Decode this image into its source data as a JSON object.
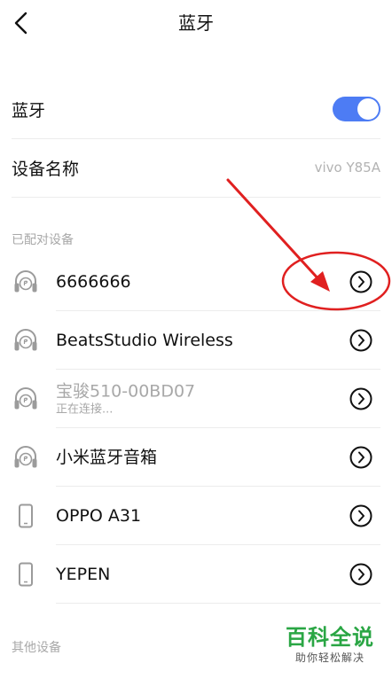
{
  "header": {
    "title": "蓝牙",
    "back_icon": "chevron-left-icon"
  },
  "bluetooth": {
    "label": "蓝牙",
    "enabled": true,
    "toggle_color": "#4d7cf4"
  },
  "device_name": {
    "label": "设备名称",
    "value": "vivo Y85A"
  },
  "paired_section": {
    "title": "已配对设备",
    "devices": [
      {
        "name": "6666666",
        "status": "",
        "icon": "headphones-icon",
        "dim": false
      },
      {
        "name": "BeatsStudio Wireless",
        "status": "",
        "icon": "headphones-icon",
        "dim": false
      },
      {
        "name": "宝骏510-00BD07",
        "status": "正在连接...",
        "icon": "headphones-icon",
        "dim": true
      },
      {
        "name": "小米蓝牙音箱",
        "status": "",
        "icon": "headphones-icon",
        "dim": false
      },
      {
        "name": "OPPO A31",
        "status": "",
        "icon": "phone-icon",
        "dim": false
      },
      {
        "name": "YEPEN",
        "status": "",
        "icon": "phone-icon",
        "dim": false
      }
    ],
    "detail_icon": "chevron-right-circle-icon"
  },
  "other_section": {
    "title": "其他设备"
  },
  "annotation": {
    "color": "#e02020",
    "shape": "red arrow pointing to circled detail button of first paired device"
  },
  "watermark": {
    "main": "百科全说",
    "sub": "助你轻松解决",
    "color": "#2aa644"
  }
}
